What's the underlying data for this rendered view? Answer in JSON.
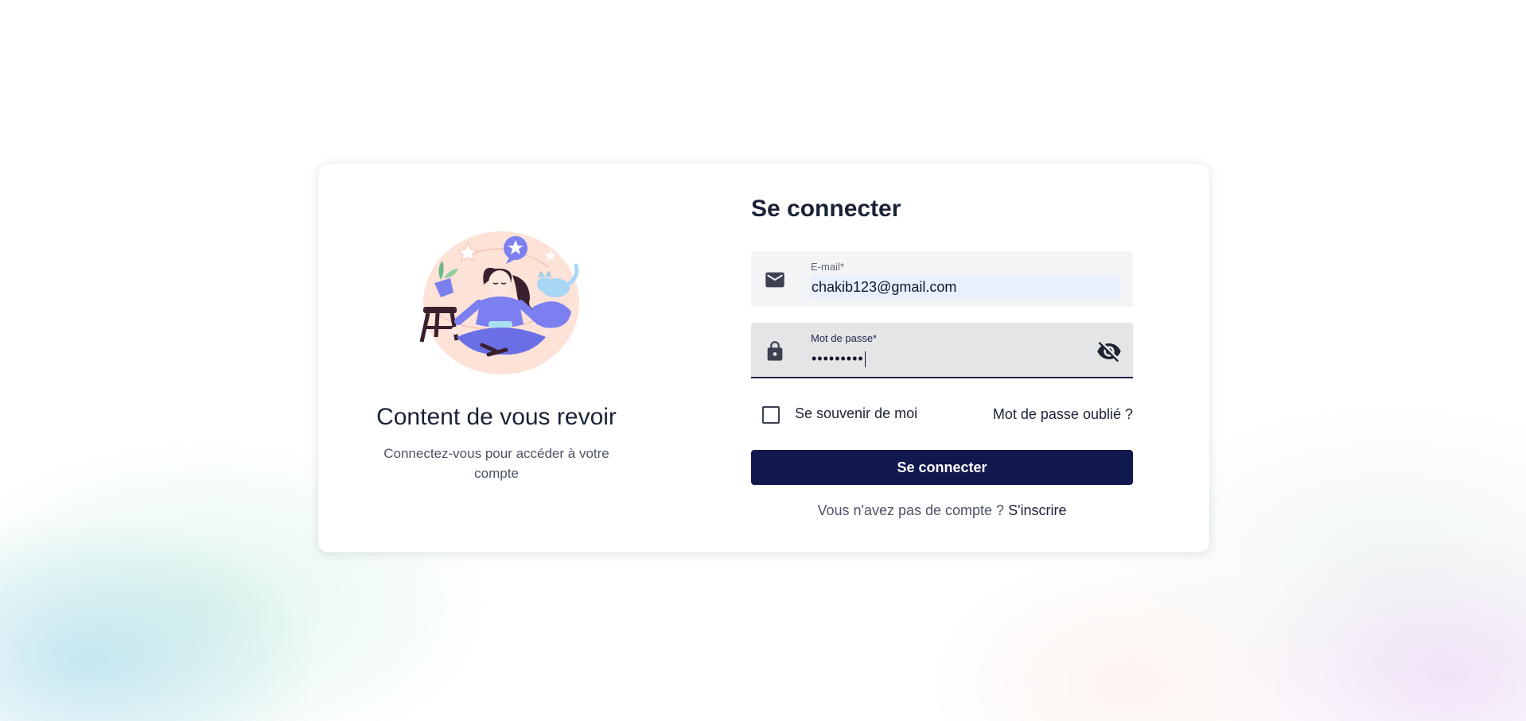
{
  "welcome": {
    "title": "Content de vous revoir",
    "subtitle": "Connectez-vous pour accéder à votre compte"
  },
  "form": {
    "title": "Se connecter",
    "email": {
      "label": "E-mail*",
      "value": "chakib123@gmail.com",
      "icon": "mail-icon"
    },
    "password": {
      "label": "Mot de passe*",
      "value": "•••••••••",
      "icon": "lock-icon",
      "toggle_icon": "eye-off-icon"
    },
    "remember_label": "Se souvenir de moi",
    "forgot_label": "Mot de passe oublié ?",
    "submit_label": "Se connecter",
    "signup_prompt": "Vous n'avez pas de compte ?",
    "signup_label": "S'inscrire"
  },
  "colors": {
    "primary": "#11184d",
    "field_bg": "#f3f4f5",
    "autofill_bg": "#e8effd",
    "illustration_accent": "#7b7ff0",
    "illustration_blob": "#fde2d8"
  }
}
